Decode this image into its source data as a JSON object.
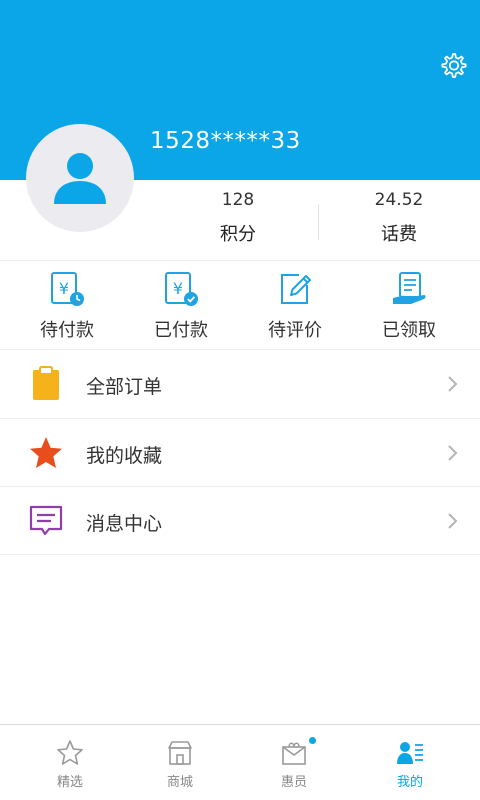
{
  "profile": {
    "phone": "1528*****33",
    "settings_icon": "gear-icon",
    "avatar_icon": "user-avatar-icon"
  },
  "stats": [
    {
      "value": "128",
      "label": "积分"
    },
    {
      "value": "24.52",
      "label": "话费"
    }
  ],
  "orders": [
    {
      "label": "待付款",
      "icon": "yuan-clock-icon"
    },
    {
      "label": "已付款",
      "icon": "yuan-check-icon"
    },
    {
      "label": "待评价",
      "icon": "edit-icon"
    },
    {
      "label": "已领取",
      "icon": "receipt-hand-icon"
    }
  ],
  "menu": [
    {
      "label": "全部订单",
      "icon": "clipboard-icon"
    },
    {
      "label": "我的收藏",
      "icon": "star-icon"
    },
    {
      "label": "消息中心",
      "icon": "message-icon"
    }
  ],
  "tabbar": [
    {
      "label": "精选",
      "icon": "star-outline-icon",
      "active": false
    },
    {
      "label": "商城",
      "icon": "store-icon",
      "active": false
    },
    {
      "label": "惠员",
      "icon": "gift-box-icon",
      "active": false,
      "badge": true
    },
    {
      "label": "我的",
      "icon": "user-list-icon",
      "active": true
    }
  ],
  "colors": {
    "primary": "#0aa6e8",
    "order_icon": "#1fa3e3",
    "clipboard": "#f6b21b",
    "star": "#e84d1c",
    "message": "#8e3fa8"
  }
}
